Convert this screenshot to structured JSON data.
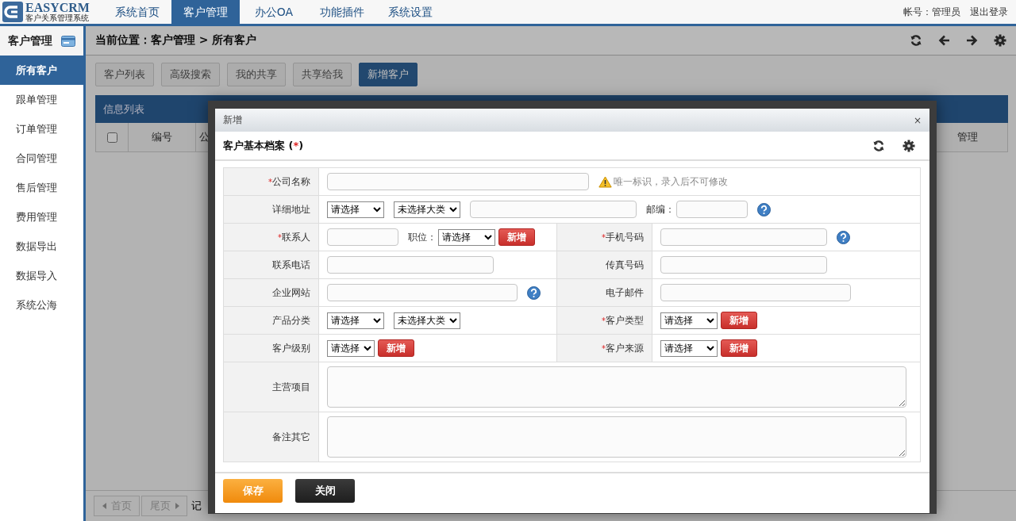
{
  "header": {
    "logo": {
      "title": "EASYCRM",
      "subtitle": "客户关系管理系统"
    },
    "nav": [
      {
        "label": "系统首页",
        "selected": false
      },
      {
        "label": "客户管理",
        "selected": true
      },
      {
        "label": "办公OA",
        "selected": false
      },
      {
        "label": "功能插件",
        "selected": false
      },
      {
        "label": "系统设置",
        "selected": false
      }
    ],
    "account": "帐号：管理员",
    "logout": "退出登录"
  },
  "sidebar": {
    "title": "客户管理",
    "items": [
      {
        "label": "所有客户",
        "selected": true
      },
      {
        "label": "跟单管理",
        "selected": false
      },
      {
        "label": "订单管理",
        "selected": false
      },
      {
        "label": "合同管理",
        "selected": false
      },
      {
        "label": "售后管理",
        "selected": false
      },
      {
        "label": "费用管理",
        "selected": false
      },
      {
        "label": "数据导出",
        "selected": false
      },
      {
        "label": "数据导入",
        "selected": false
      },
      {
        "label": "系统公海",
        "selected": false
      }
    ]
  },
  "breadcrumb": "当前位置：客户管理 > 所有客户",
  "toolbar": [
    {
      "label": "客户列表",
      "selected": false
    },
    {
      "label": "高级搜索",
      "selected": false
    },
    {
      "label": "我的共享",
      "selected": false
    },
    {
      "label": "共享给我",
      "selected": false
    },
    {
      "label": "新增客户",
      "selected": true
    }
  ],
  "panel": {
    "title": "信息列表",
    "select_all": {
      "checked": false
    },
    "columns": [
      "编号",
      "公",
      "管理"
    ]
  },
  "pager": {
    "first": "首页",
    "last": "尾页",
    "record_label": "记"
  },
  "dialog": {
    "title": "新增",
    "close": "×",
    "section_title": "客户基本档案",
    "section_suffix": [
      {
        "text": "(",
        "kind": "plain"
      },
      {
        "text": "*",
        "kind": "required"
      },
      {
        "text": ")",
        "kind": "plain"
      }
    ],
    "rows": [
      {
        "kind": "full",
        "fields": [
          {
            "label": "公司名称",
            "mark": "*",
            "controls": [
              {
                "kind": "input-xl"
              },
              {
                "kind": "hint",
                "text": "唯一标识，录入后不可修改"
              }
            ]
          }
        ]
      },
      {
        "kind": "full",
        "fields": [
          {
            "label": "详细地址",
            "controls": [
              {
                "kind": "select",
                "text": "请选择"
              },
              {
                "kind": "select-wide",
                "text": "未选择大类"
              },
              {
                "kind": "input"
              },
              {
                "kind": "text",
                "text": "邮编："
              },
              {
                "kind": "input-short"
              },
              {
                "kind": "help"
              }
            ]
          }
        ]
      },
      {
        "kind": "half",
        "fields": [
          {
            "label": "联系人",
            "mark": "*",
            "controls": [
              {
                "kind": "input-short"
              },
              {
                "kind": "text",
                "text": "职位："
              },
              {
                "kind": "select",
                "text": "请选择"
              },
              {
                "kind": "button",
                "text": "新增"
              }
            ]
          },
          {
            "label": "手机号码",
            "mark": "*",
            "controls": [
              {
                "kind": "input"
              },
              {
                "kind": "help"
              }
            ]
          }
        ]
      },
      {
        "kind": "half",
        "fields": [
          {
            "label": "联系电话",
            "controls": [
              {
                "kind": "input"
              }
            ]
          },
          {
            "label": "传真号码",
            "controls": [
              {
                "kind": "input"
              }
            ]
          }
        ]
      },
      {
        "kind": "half",
        "fields": [
          {
            "label": "企业网站",
            "controls": [
              {
                "kind": "input-long"
              },
              {
                "kind": "help"
              }
            ]
          },
          {
            "label": "电子邮件",
            "controls": [
              {
                "kind": "input-long"
              }
            ]
          }
        ]
      },
      {
        "kind": "half",
        "fields": [
          {
            "label": "产品分类",
            "controls": [
              {
                "kind": "select",
                "text": "请选择"
              },
              {
                "kind": "select-wide",
                "text": "未选择大类"
              }
            ]
          },
          {
            "label": "客户类型",
            "mark": "*",
            "controls": [
              {
                "kind": "select",
                "text": "请选择"
              },
              {
                "kind": "button",
                "text": "新增"
              }
            ]
          }
        ]
      },
      {
        "kind": "half",
        "fields": [
          {
            "label": "客户级别",
            "controls": [
              {
                "kind": "select-narrow",
                "text": "请选择"
              },
              {
                "kind": "button",
                "text": "新增"
              }
            ]
          },
          {
            "label": "客户来源",
            "mark": "*",
            "controls": [
              {
                "kind": "select",
                "text": "请选择"
              },
              {
                "kind": "button",
                "text": "新增"
              }
            ]
          }
        ]
      },
      {
        "kind": "full",
        "fields": [
          {
            "label": "主营项目",
            "controls": [
              {
                "kind": "textarea"
              }
            ]
          }
        ]
      },
      {
        "kind": "full",
        "fields": [
          {
            "label": "备注其它",
            "controls": [
              {
                "kind": "textarea"
              }
            ]
          }
        ]
      }
    ],
    "buttons": [
      {
        "label": "保存",
        "kind": "primary"
      },
      {
        "label": "关闭",
        "kind": "dark"
      }
    ]
  }
}
